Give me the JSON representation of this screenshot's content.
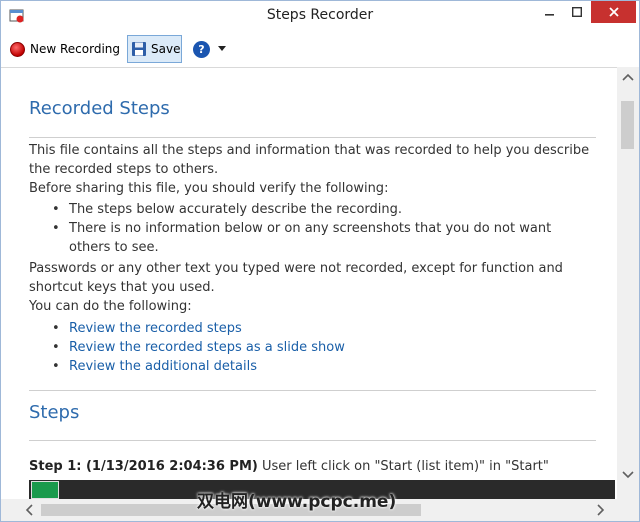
{
  "window": {
    "title": "Steps Recorder",
    "colors": {
      "accent": "#2e6bad",
      "link": "#1a5fa8",
      "close": "#c7312f"
    }
  },
  "toolbar": {
    "new_recording_label": "New Recording",
    "save_label": "Save",
    "icons": [
      "record-dot-icon",
      "floppy-disk-icon",
      "help-icon",
      "dropdown-arrow-icon"
    ]
  },
  "content": {
    "recorded_heading": "Recorded Steps",
    "intro_line": "This file contains all the steps and information that was recorded to help you describe the recorded steps to others.",
    "verify_intro": "Before sharing this file, you should verify the following:",
    "verify_items": [
      "The steps below accurately describe the recording.",
      "There is no information below or on any screenshots that you do not want others to see."
    ],
    "passwords_note": "Passwords or any other text you typed were not recorded, except for function and shortcut keys that you used.",
    "can_do": "You can do the following:",
    "links": [
      "Review the recorded steps",
      "Review the recorded steps as a slide show",
      "Review the additional details"
    ],
    "steps_heading": "Steps",
    "step1": {
      "label": "Step 1: (1/13/2016 2:04:36 PM)",
      "description": "User left click on \"Start (list item)\" in \"Start\""
    }
  },
  "watermark": "双电网(www.pcpc.me)"
}
